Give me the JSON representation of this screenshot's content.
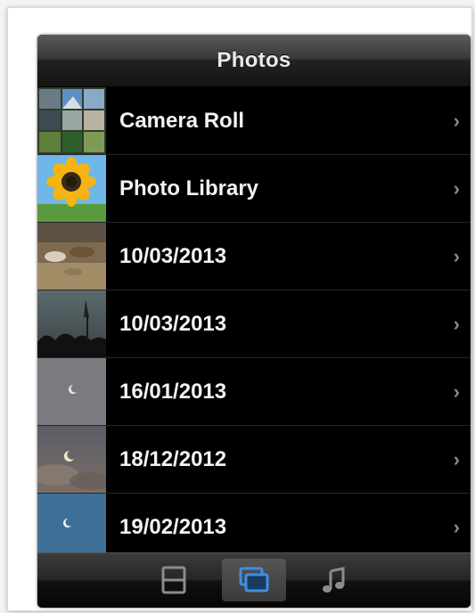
{
  "navbar": {
    "title": "Photos"
  },
  "albums": [
    {
      "label": "Camera Roll",
      "thumb": "camera-roll-thumbnail"
    },
    {
      "label": "Photo Library",
      "thumb": "sunflower-thumbnail"
    },
    {
      "label": "10/03/2013",
      "thumb": "animals-on-ground-thumbnail"
    },
    {
      "label": "10/03/2013",
      "thumb": "dusk-trees-thumbnail"
    },
    {
      "label": "16/01/2013",
      "thumb": "moon-grey-sky-thumbnail"
    },
    {
      "label": "18/12/2012",
      "thumb": "moon-cloudy-sky-thumbnail"
    },
    {
      "label": "19/02/2013",
      "thumb": "moon-blue-sky-thumbnail"
    }
  ],
  "tabbar": {
    "tabs": [
      {
        "icon": "film-strip-icon",
        "active": false
      },
      {
        "icon": "photos-icon",
        "active": true
      },
      {
        "icon": "music-note-icon",
        "active": false
      }
    ]
  },
  "colors": {
    "active_tab_icon": "#3d8fe6",
    "inactive_tab_icon": "#8c8c8c",
    "row_text": "#f2f2f2",
    "chevron": "#8a8a8a"
  }
}
